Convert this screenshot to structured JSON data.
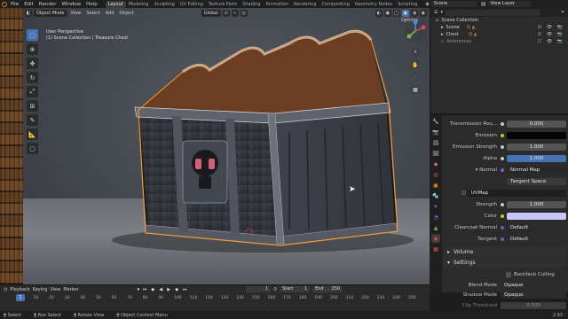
{
  "menu": [
    "File",
    "Edit",
    "Render",
    "Window",
    "Help"
  ],
  "workspaces": [
    "Layout",
    "Modeling",
    "Sculpting",
    "UV Editing",
    "Texture Paint",
    "Shading",
    "Animation",
    "Rendering",
    "Compositing",
    "Geometry Nodes",
    "Scripting"
  ],
  "active_workspace": "Layout",
  "scene_name": "Scene",
  "view_layer": "View Layer",
  "viewport": {
    "mode": "Object Mode",
    "menus": [
      "View",
      "Select",
      "Add",
      "Object"
    ],
    "transform": "Global",
    "options": "Options",
    "info_line1": "User Perspective",
    "info_line2": "(1) Scene Collection | Treasure Chest"
  },
  "outliner": {
    "collection": "Scene Collection",
    "items": [
      "Scene",
      "Chest",
      "References"
    ]
  },
  "properties": {
    "rows": [
      {
        "label": "Transmission Rou...",
        "value": "0.000",
        "style": "num"
      },
      {
        "label": "Emission",
        "value": "",
        "style": "black"
      },
      {
        "label": "Emission Strength",
        "value": "1.000",
        "style": "num"
      },
      {
        "label": "Alpha",
        "value": "1.000",
        "style": "blue"
      },
      {
        "label": "Normal",
        "value": "Normal Map",
        "style": "left"
      },
      {
        "label": "",
        "value": "Tangent Space",
        "style": "left"
      },
      {
        "label": "",
        "value": "UVMap",
        "style": "left"
      },
      {
        "label": "Strength",
        "value": "1.000",
        "style": "num"
      },
      {
        "label": "Color",
        "value": "",
        "style": "lilac"
      },
      {
        "label": "Clearcoat Normal",
        "value": "Default",
        "style": "left"
      },
      {
        "label": "Tangent",
        "value": "Default",
        "style": "left"
      }
    ],
    "volume": "Volume",
    "settings": "Settings",
    "backface": "Backface Culling",
    "blend_mode_label": "Blend Mode",
    "blend_mode": "Opaque",
    "shadow_mode_label": "Shadow Mode",
    "shadow_mode": "Opaque",
    "clip_label": "Clip Threshold",
    "clip_value": "0.500"
  },
  "timeline": {
    "menus": [
      "Playback",
      "Keying",
      "View",
      "Marker"
    ],
    "current_frame": "1",
    "start_label": "Start",
    "start": "1",
    "end_label": "End",
    "end": "250",
    "ticks": [
      "0",
      "10",
      "20",
      "30",
      "40",
      "50",
      "60",
      "70",
      "80",
      "90",
      "100",
      "110",
      "120",
      "130",
      "140",
      "150",
      "160",
      "170",
      "180",
      "190",
      "200",
      "210",
      "220",
      "230",
      "240",
      "250"
    ]
  },
  "status": {
    "select": "Select",
    "box_select": "Box Select",
    "rotate": "Rotate View",
    "context": "Object Context Menu",
    "version": "2.93"
  }
}
